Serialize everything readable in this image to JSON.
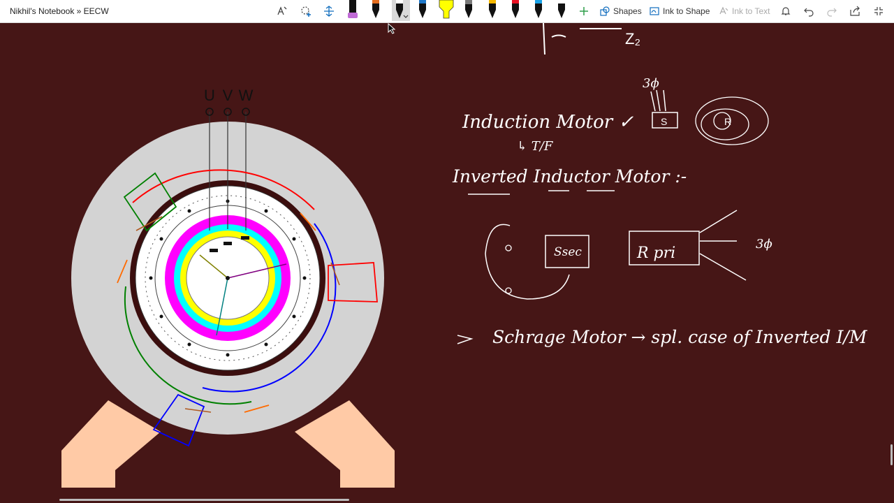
{
  "breadcrumb": "Nikhil's Notebook » EECW",
  "toolbar": {
    "shapes_label": "Shapes",
    "ink_to_shape_label": "Ink to Shape",
    "ink_to_text_label": "Ink to Text",
    "pen_colors": [
      "#000000",
      "#e36d1e",
      "#000000",
      "#1f78c8",
      "#ffff00",
      "#7a7a7a",
      "#f5b800",
      "#e81123",
      "#1aa3e8",
      "#000000"
    ],
    "accent_color": "#0f6cbd"
  },
  "diagram": {
    "terminal_labels": [
      "U",
      "V",
      "W"
    ],
    "colors": {
      "stator_body": "#d3d3d3",
      "stand": "#ffcaa6",
      "slip_ring_outer": "#ff00ff",
      "slip_ring_middle": "#00ffff",
      "slip_ring_inner": "#ffff00",
      "phase_red": "#ff0000",
      "phase_blue": "#0000ff",
      "phase_green": "#008000",
      "brush_arrow": "#ff6a00"
    }
  },
  "notes": {
    "line1": "Induction Motor ✓",
    "line1_sub": "↳ T/F",
    "line2": "Inverted Inductor Motor :-",
    "label_3phi_top": "3ϕ",
    "label_s": "S",
    "label_r": "R",
    "label_ssec": "Ssec",
    "label_rpri": "R pri",
    "label_3phi_right": "3ϕ",
    "line3": "Schrage Motor → spl. case of Inverted I/M",
    "top_fragment": "Z₂"
  }
}
